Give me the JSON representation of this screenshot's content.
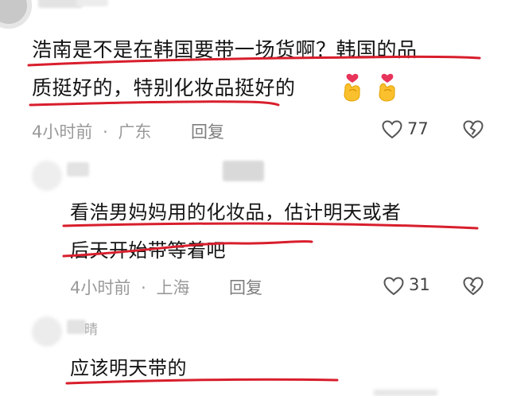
{
  "comments": [
    {
      "username": "",
      "text_lines": [
        "浩南是不是在韩国要带一场货啊？韩国的品",
        "质挺好的，特别化妆品挺好的"
      ],
      "emojis": [
        "finger-heart-emoji",
        "finger-heart-emoji"
      ],
      "time": "4小时前",
      "location": "广东",
      "reply_label": "回复",
      "likes": "77"
    },
    {
      "username": "",
      "text_lines": [
        "看浩男妈妈用的化妆品，估计明天或者",
        "后天开始带等着吧"
      ],
      "time": "4小时前",
      "location": "上海",
      "reply_label": "回复",
      "likes": "31"
    },
    {
      "username": "晴",
      "text_lines": [
        "应该明天带的"
      ]
    }
  ],
  "separator": "·",
  "colors": {
    "underline": "#d81e2c",
    "meta_text": "#9a9a9a",
    "primary_text": "#141414"
  },
  "icons": {
    "like": "heart-outline-icon",
    "dislike": "broken-heart-icon"
  }
}
